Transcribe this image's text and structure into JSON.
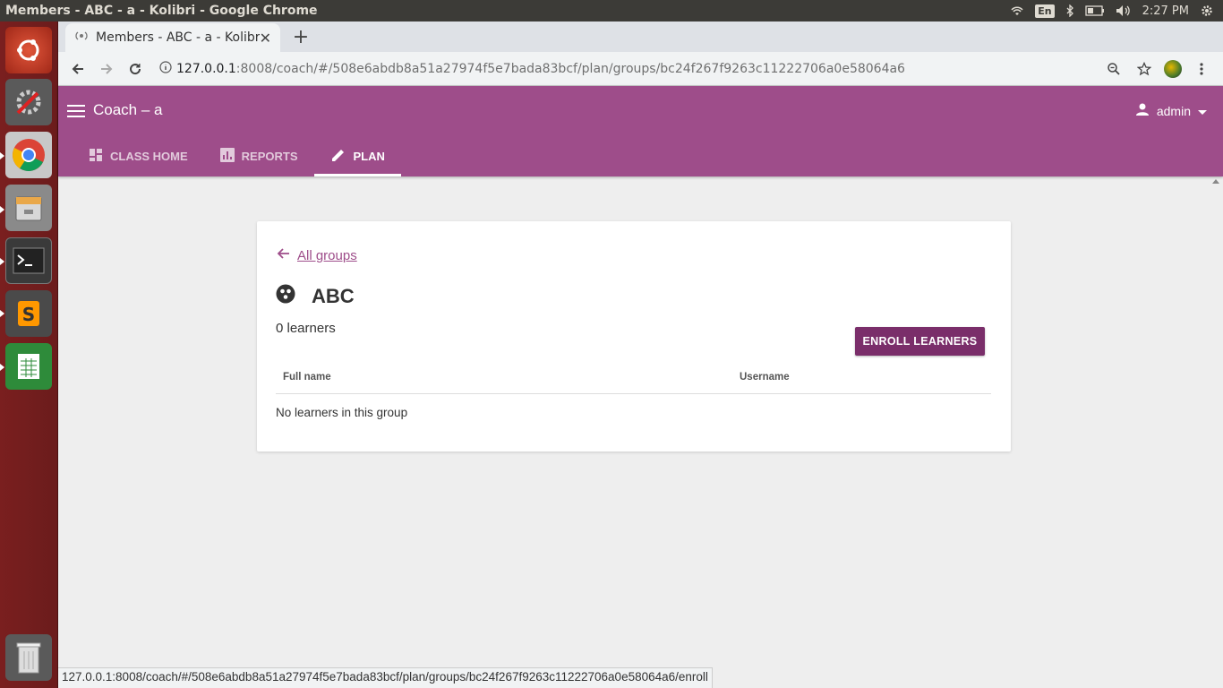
{
  "os": {
    "window_title": "Members - ABC - a - Kolibri - Google Chrome",
    "lang": "En",
    "clock": "2:27 PM"
  },
  "browser": {
    "tab_title": "Members - ABC - a - Kolibri",
    "url_host": "127.0.0.1",
    "url_rest": ":8008/coach/#/508e6abdb8a51a27974f5e7bada83bcf/plan/groups/bc24f267f9263c11222706a0e58064a6",
    "status_url": "127.0.0.1:8008/coach/#/508e6abdb8a51a27974f5e7bada83bcf/plan/groups/bc24f267f9263c11222706a0e58064a6/enroll"
  },
  "app": {
    "title": "Coach – a",
    "user": "admin",
    "tabs": [
      {
        "label": "CLASS HOME",
        "icon": "dashboard-icon"
      },
      {
        "label": "REPORTS",
        "icon": "bar-chart-icon"
      },
      {
        "label": "PLAN",
        "icon": "pencil-icon"
      }
    ],
    "active_tab": "PLAN",
    "accent_color": "#9e4d8a",
    "button_color": "#7a2e6a"
  },
  "group": {
    "back_label": "All groups",
    "name": "ABC",
    "learner_count": "0 learners",
    "enroll_label": "ENROLL LEARNERS",
    "columns": [
      "Full name",
      "Username"
    ],
    "empty_message": "No learners in this group"
  }
}
